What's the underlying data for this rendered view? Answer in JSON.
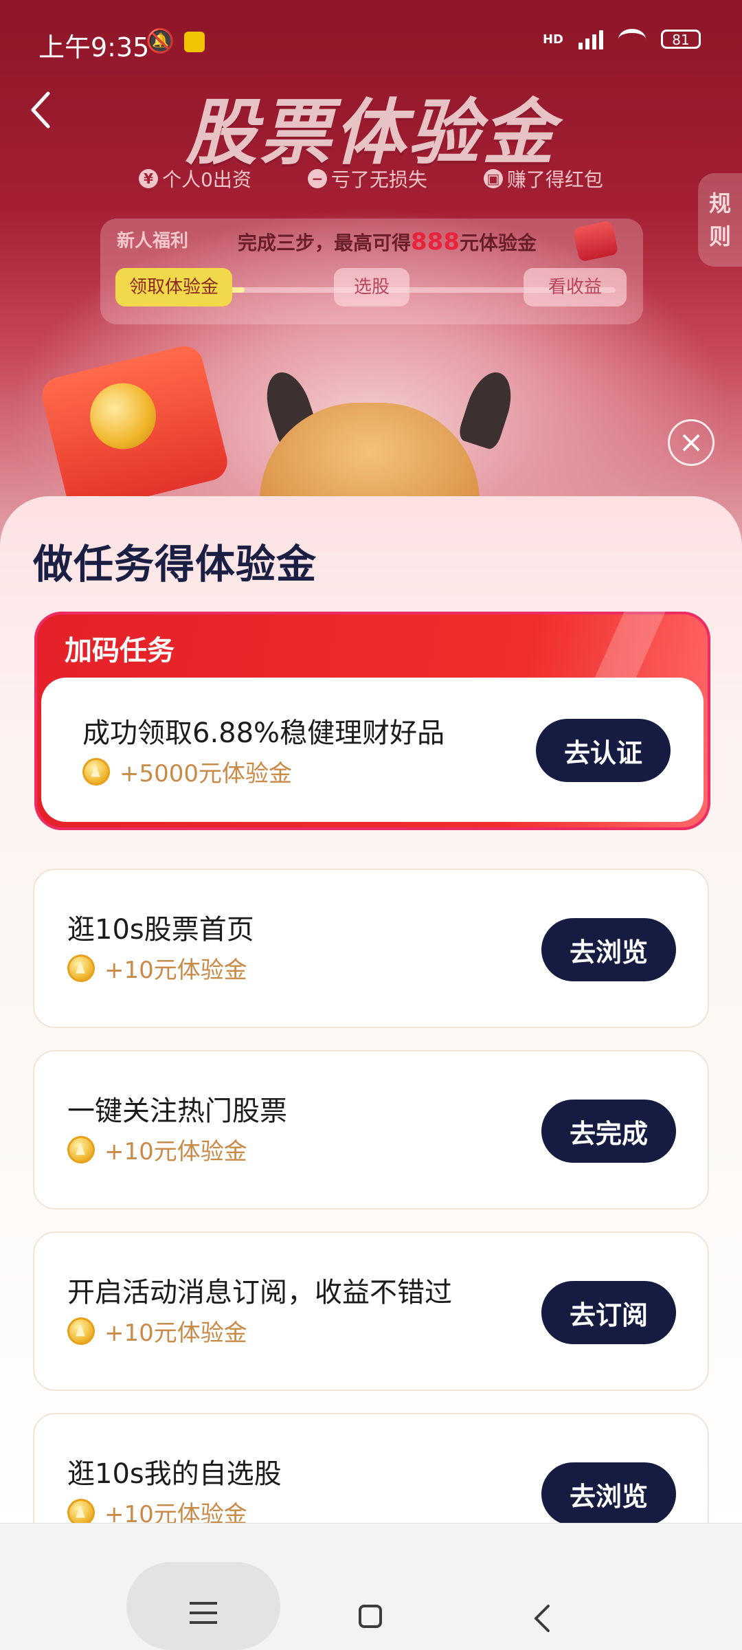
{
  "status_bar": {
    "time": "上午9:35",
    "battery": "81",
    "network": "HD"
  },
  "header": {
    "title": "股票体验金",
    "perks": [
      {
        "icon": "¥",
        "label": "个人0出资"
      },
      {
        "icon": "−",
        "label": "亏了无损失"
      },
      {
        "icon": "▣",
        "label": "赚了得红包"
      }
    ],
    "rules_label": "规则"
  },
  "progress": {
    "tag": "新人福利",
    "text_prefix": "完成三步，最高可得",
    "text_highlight": "888",
    "text_suffix": "元体验金",
    "steps": [
      "领取体验金",
      "选股",
      "看收益"
    ],
    "current_step": 1,
    "fill_fraction": 0.25
  },
  "sheet": {
    "title": "做任务得体验金",
    "bonus": {
      "tag": "加码任务",
      "task": {
        "title": "成功领取6.88%稳健理财好品",
        "reward": "+5000元体验金",
        "button": "去认证"
      }
    },
    "tasks": [
      {
        "title": "逛10s股票首页",
        "reward": "+10元体验金",
        "button": "去浏览"
      },
      {
        "title": "一键关注热门股票",
        "reward": "+10元体验金",
        "button": "去完成"
      },
      {
        "title": "开启活动消息订阅，收益不错过",
        "reward": "+10元体验金",
        "button": "去订阅"
      },
      {
        "title": "逛10s我的自选股",
        "reward": "+10元体验金",
        "button": "去浏览"
      }
    ]
  },
  "colors": {
    "header_red": "#a41f33",
    "button_navy": "#161b42",
    "reward_gold": "#c88a46",
    "highlight_red": "#e8243c"
  }
}
